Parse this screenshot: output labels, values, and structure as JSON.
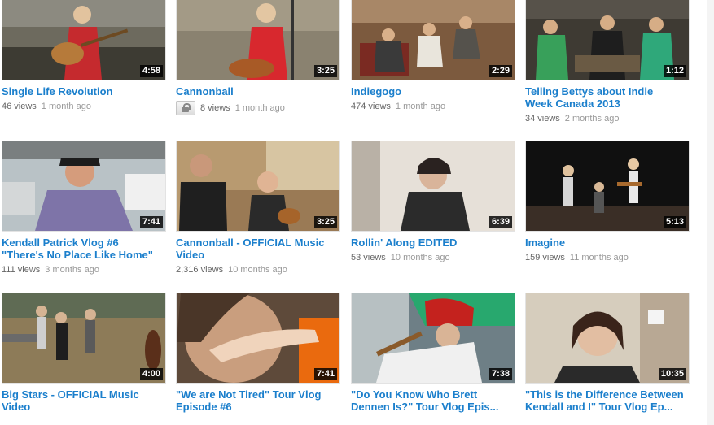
{
  "videos": [
    {
      "title": "Single Life Revolution",
      "duration": "4:58",
      "views": "46 views",
      "ago": "1 month ago",
      "private": false
    },
    {
      "title": "Cannonball",
      "duration": "3:25",
      "views": "8 views",
      "ago": "1 month ago",
      "private": true
    },
    {
      "title": "Indiegogo",
      "duration": "2:29",
      "views": "474 views",
      "ago": "1 month ago",
      "private": false
    },
    {
      "title": "Telling Bettys about Indie\nWeek Canada 2013",
      "duration": "1:12",
      "views": "34 views",
      "ago": "2 months ago",
      "private": false
    },
    {
      "title": "Kendall Patrick Vlog #6\n\"There's No Place Like Home\"",
      "duration": "7:41",
      "views": "111 views",
      "ago": "3 months ago",
      "private": false
    },
    {
      "title": "Cannonball - OFFICIAL Music\nVideo",
      "duration": "3:25",
      "views": "2,316 views",
      "ago": "10 months ago",
      "private": false
    },
    {
      "title": "Rollin' Along EDITED",
      "duration": "6:39",
      "views": "53 views",
      "ago": "10 months ago",
      "private": false
    },
    {
      "title": "Imagine",
      "duration": "5:13",
      "views": "159 views",
      "ago": "11 months ago",
      "private": false
    },
    {
      "title": "Big Stars - OFFICIAL Music\nVideo",
      "duration": "4:00",
      "views": "",
      "ago": "",
      "private": false
    },
    {
      "title": "\"We are Not Tired\" Tour Vlog\nEpisode #6",
      "duration": "7:41",
      "views": "",
      "ago": "",
      "private": false
    },
    {
      "title": "\"Do You Know Who Brett\nDennen Is?\" Tour Vlog Epis...",
      "duration": "7:38",
      "views": "",
      "ago": "",
      "private": false
    },
    {
      "title": "\"This is the Difference Between\nKendall and I\" Tour Vlog Ep...",
      "duration": "10:35",
      "views": "",
      "ago": "",
      "private": false
    }
  ]
}
